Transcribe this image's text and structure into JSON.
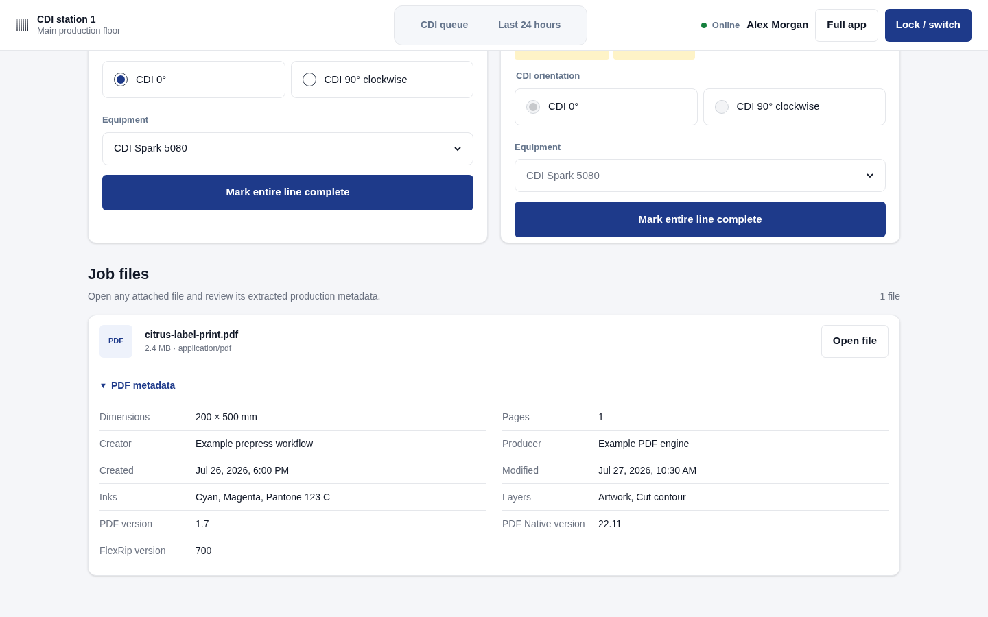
{
  "header": {
    "title": "CDI station 1",
    "subtitle": "Main production floor",
    "tabs": [
      {
        "label": "CDI queue",
        "selected": false
      },
      {
        "label": "Last 24 hours",
        "selected": false
      }
    ],
    "status": {
      "label": "Online",
      "color": "#15803d"
    },
    "user": "Alex Morgan",
    "buttons": [
      {
        "label": "Full app",
        "kind": "secondary"
      },
      {
        "label": "Lock / switch",
        "kind": "primary"
      }
    ]
  },
  "lines": [
    {
      "disabled": false,
      "orientation": {
        "options": [
          {
            "label": "CDI 0°",
            "selected": true
          },
          {
            "label": "CDI 90° clockwise",
            "selected": false
          }
        ]
      },
      "equipment": {
        "label": "Equipment",
        "value": "CDI Spark 5080"
      },
      "action": "Mark entire line complete"
    },
    {
      "disabled": true,
      "badges": [
        {
          "kind": "warning"
        },
        {
          "kind": "warning"
        }
      ],
      "orientation": {
        "label": "CDI orientation",
        "options": [
          {
            "label": "CDI 0°",
            "selected": true
          },
          {
            "label": "CDI 90° clockwise",
            "selected": false
          }
        ]
      },
      "equipment": {
        "label": "Equipment",
        "value": "CDI Spark 5080"
      },
      "action": "Mark entire line complete"
    }
  ],
  "job_files": {
    "title": "Job files",
    "description": "Open any attached file and review its extracted production metadata.",
    "count": "1 file",
    "files": [
      {
        "type": "PDF",
        "name": "citrus-label-print.pdf",
        "meta": "2.4 MB · application/pdf",
        "action": "Open file",
        "details": {
          "toggle": "▼",
          "label": "PDF metadata",
          "expanded": true,
          "columns": [
            [
              {
                "key": "Dimensions",
                "value": "200 × 500 mm"
              },
              {
                "key": "Creator",
                "value": "Example prepress workflow"
              },
              {
                "key": "Created",
                "value": "Jul 26, 2026, 6:00 PM"
              },
              {
                "key": "Inks",
                "value": "Cyan, Magenta, Pantone 123 C"
              },
              {
                "key": "PDF version",
                "value": "1.7"
              },
              {
                "key": "FlexRip version",
                "value": "700"
              }
            ],
            [
              {
                "key": "Pages",
                "value": "1"
              },
              {
                "key": "Producer",
                "value": "Example PDF engine"
              },
              {
                "key": "Modified",
                "value": "Jul 27, 2026, 10:30 AM"
              },
              {
                "key": "Layers",
                "value": "Artwork, Cut contour"
              },
              {
                "key": "PDF Native version",
                "value": "22.11"
              }
            ]
          ]
        }
      }
    ]
  }
}
